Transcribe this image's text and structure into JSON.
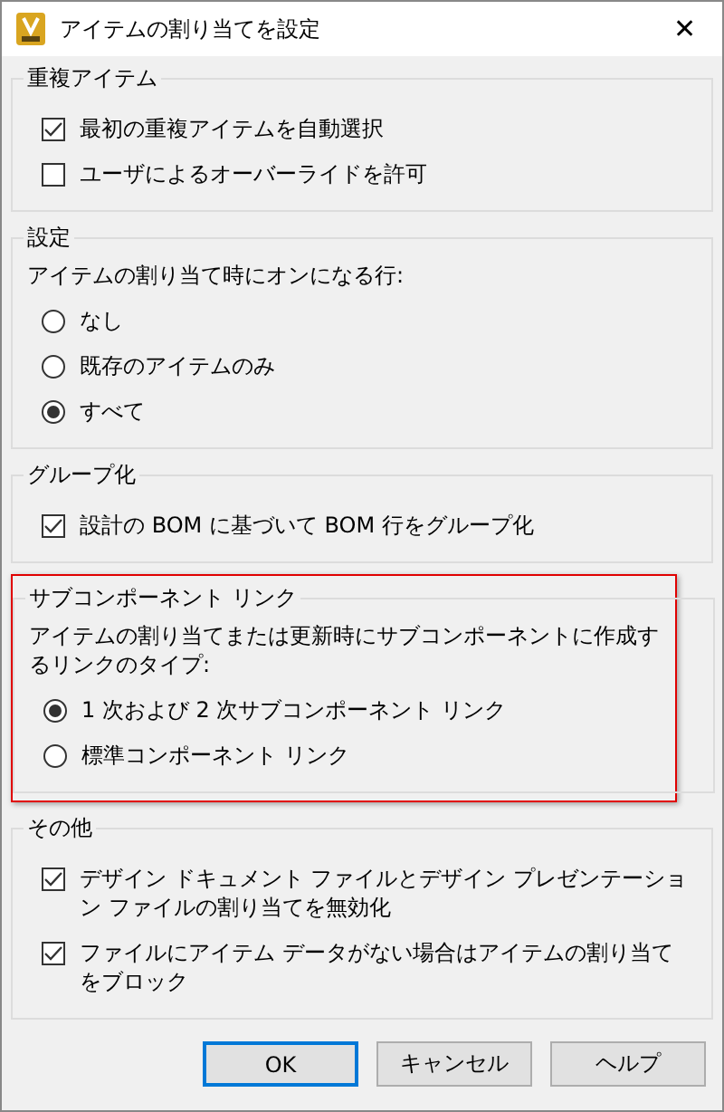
{
  "window": {
    "title": "アイテムの割り当てを設定",
    "close": "✕"
  },
  "groups": [
    {
      "title": "重複アイテム",
      "highlighted": false,
      "items": [
        {
          "kind": "checkbox",
          "label": "最初の重複アイテムを自動選択",
          "checked": true
        },
        {
          "kind": "checkbox",
          "label": "ユーザによるオーバーライドを許可",
          "checked": false
        }
      ]
    },
    {
      "title": "設定",
      "highlighted": false,
      "description": "アイテムの割り当て時にオンになる行:",
      "items": [
        {
          "kind": "radio",
          "label": "なし",
          "selected": false
        },
        {
          "kind": "radio",
          "label": "既存のアイテムのみ",
          "selected": false
        },
        {
          "kind": "radio",
          "label": "すべて",
          "selected": true
        }
      ]
    },
    {
      "title": "グループ化",
      "highlighted": false,
      "items": [
        {
          "kind": "checkbox",
          "label": "設計の BOM に基づいて BOM 行をグループ化",
          "checked": true
        }
      ]
    },
    {
      "title": "サブコンポーネント リンク",
      "highlighted": true,
      "description": "アイテムの割り当てまたは更新時にサブコンポーネントに作成するリンクのタイプ:",
      "items": [
        {
          "kind": "radio",
          "label": "1 次および 2 次サブコンポーネント リンク",
          "selected": true
        },
        {
          "kind": "radio",
          "label": "標準コンポーネント リンク",
          "selected": false
        }
      ]
    },
    {
      "title": "その他",
      "highlighted": false,
      "items": [
        {
          "kind": "checkbox",
          "label": "デザイン ドキュメント ファイルとデザイン プレゼンテーション ファイルの割り当てを無効化",
          "checked": true
        },
        {
          "kind": "checkbox",
          "label": "ファイルにアイテム データがない場合はアイテムの割り当てをブロック",
          "checked": true
        }
      ]
    }
  ],
  "buttons": [
    {
      "label": "OK",
      "default": true
    },
    {
      "label": "キャンセル",
      "default": false
    },
    {
      "label": "ヘルプ",
      "default": false
    }
  ]
}
